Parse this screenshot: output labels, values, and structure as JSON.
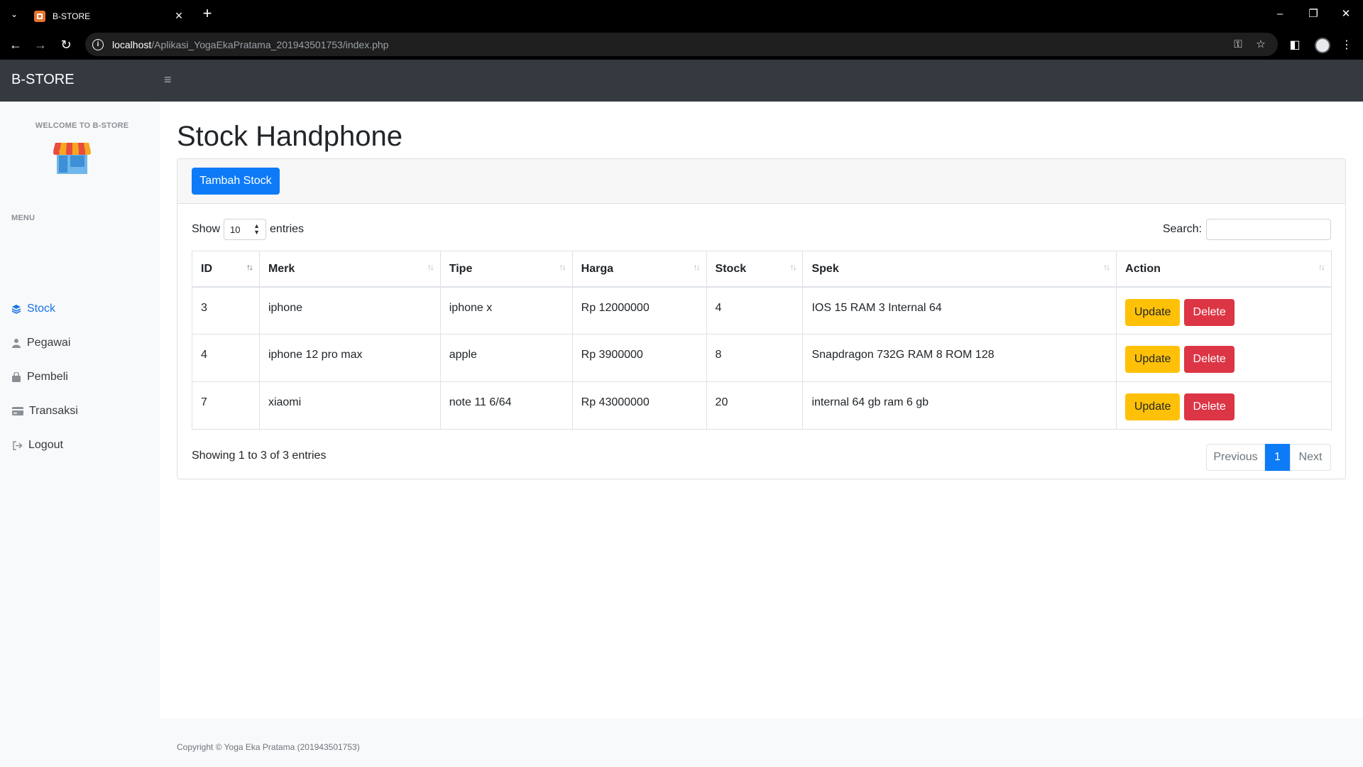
{
  "browser": {
    "tab_title": "B-STORE",
    "url_host": "localhost",
    "url_path": "/Aplikasi_YogaEkaPratama_201943501753/index.php"
  },
  "navbar": {
    "brand": "B-STORE"
  },
  "sidebar": {
    "welcome": "WELCOME TO B-STORE",
    "menu_label": "MENU",
    "items": [
      {
        "label": "Stock",
        "icon": "layers-icon",
        "active": true
      },
      {
        "label": "Pegawai",
        "icon": "user-icon",
        "active": false
      },
      {
        "label": "Pembeli",
        "icon": "shopping-bag-icon",
        "active": false
      },
      {
        "label": "Transaksi",
        "icon": "credit-card-icon",
        "active": false
      },
      {
        "label": "Logout",
        "icon": "sign-out-icon",
        "active": false
      }
    ]
  },
  "main": {
    "title": "Stock Handphone",
    "add_button": "Tambah Stock",
    "show_label": "Show",
    "entries_label": "entries",
    "page_length": "10",
    "search_label": "Search:",
    "columns": [
      "ID",
      "Merk",
      "Tipe",
      "Harga",
      "Stock",
      "Spek",
      "Action"
    ],
    "rows": [
      {
        "id": "3",
        "merk": "iphone",
        "tipe": "iphone x",
        "harga": "Rp 12000000",
        "stock": "4",
        "spek": "IOS 15 RAM 3 Internal 64"
      },
      {
        "id": "4",
        "merk": "iphone 12 pro max",
        "tipe": "apple",
        "harga": "Rp 3900000",
        "stock": "8",
        "spek": "Snapdragon 732G RAM 8 ROM 128"
      },
      {
        "id": "7",
        "merk": "xiaomi",
        "tipe": "note 11 6/64",
        "harga": "Rp 43000000",
        "stock": "20",
        "spek": "internal 64 gb ram 6 gb"
      }
    ],
    "update_label": "Update",
    "delete_label": "Delete",
    "info": "Showing 1 to 3 of 3 entries",
    "pagination": {
      "previous": "Previous",
      "current": "1",
      "next": "Next"
    }
  },
  "footer": {
    "text": "Copyright © Yoga Eka Pratama (201943501753)"
  },
  "colors": {
    "primary": "#0d7bf7",
    "warning": "#ffc107",
    "danger": "#dc3545",
    "navbar": "#343a40"
  }
}
